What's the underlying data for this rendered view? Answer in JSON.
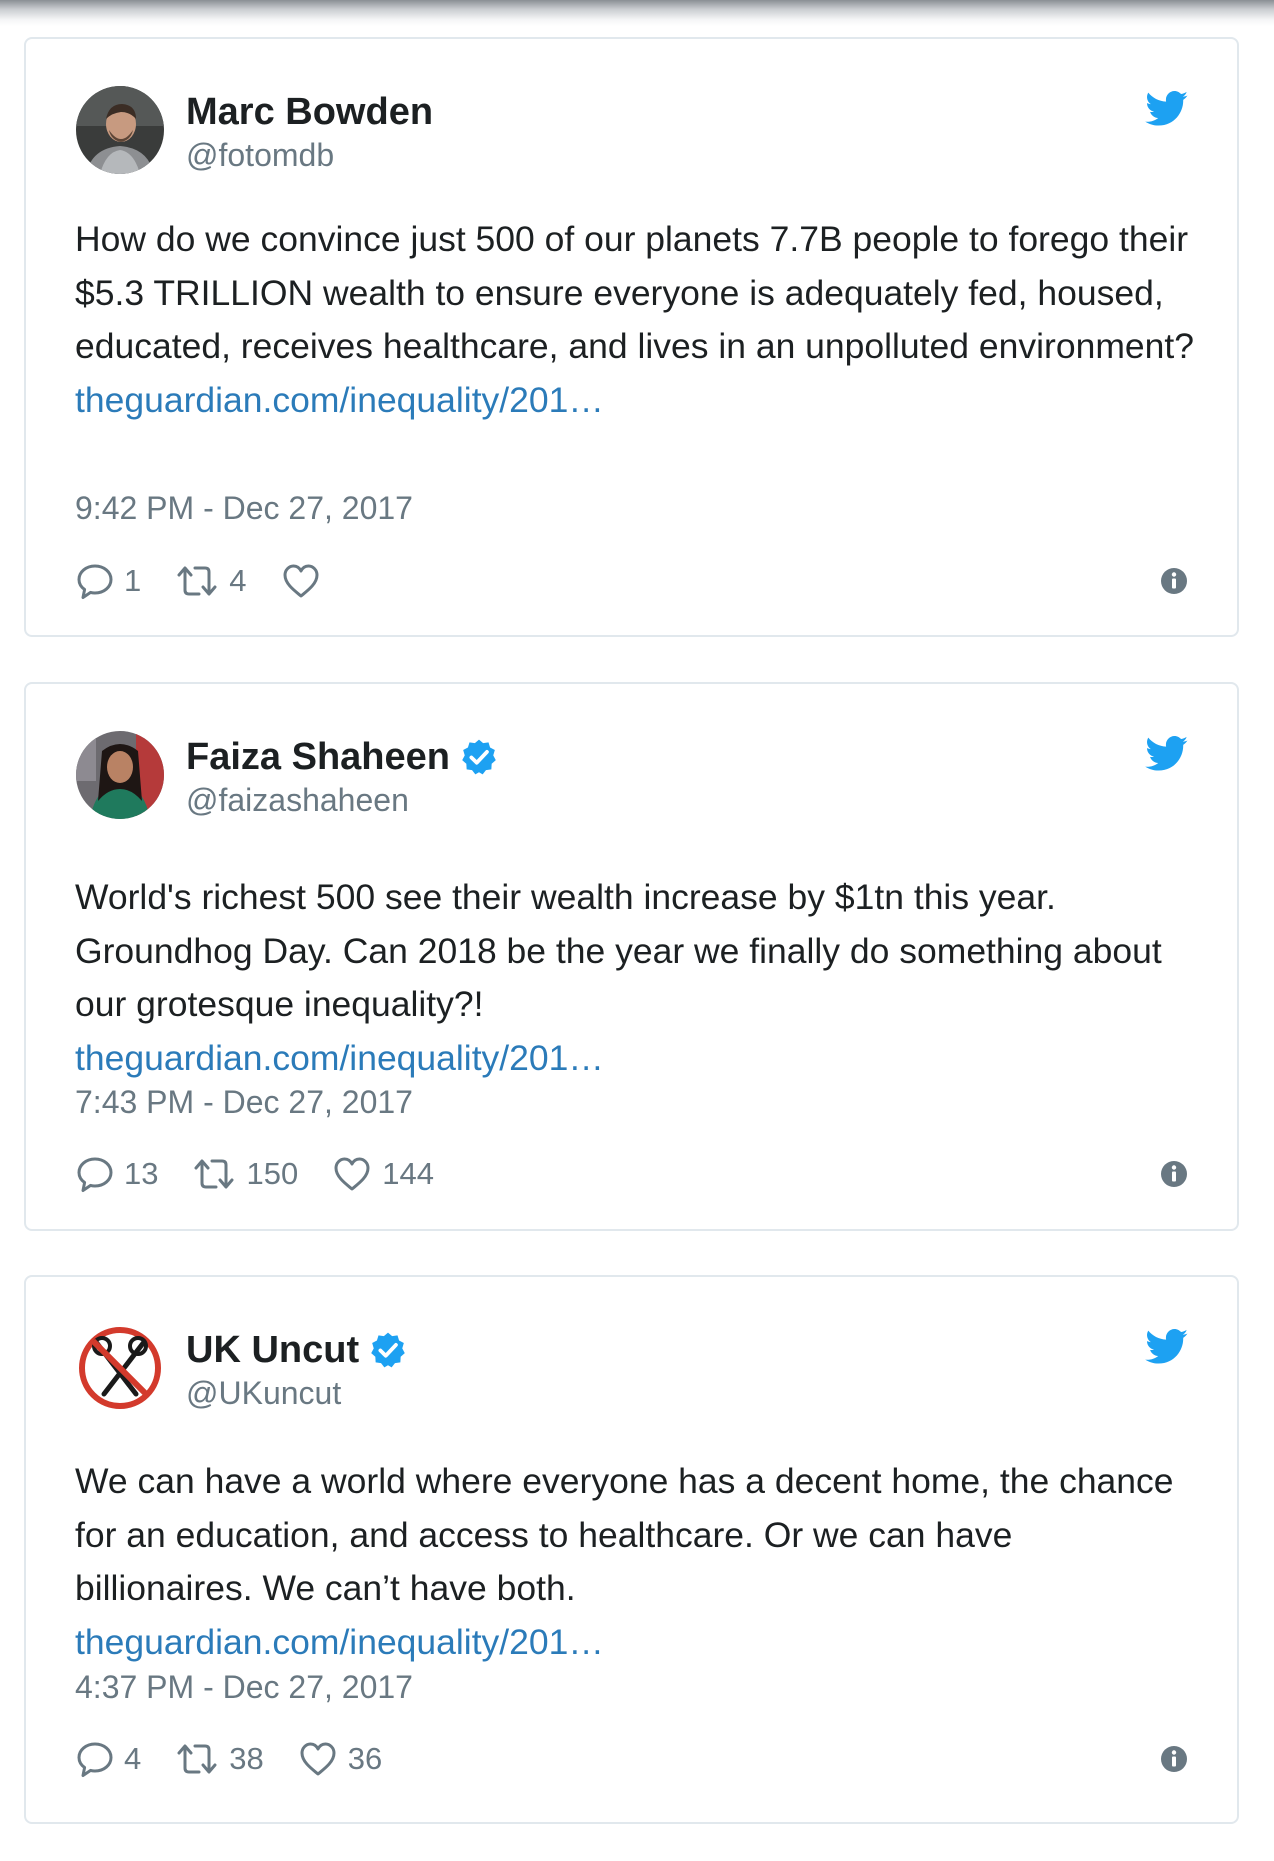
{
  "tweets": [
    {
      "name": "Marc Bowden",
      "handle": "@fotomdb",
      "verified": false,
      "text": "How do we convince just 500 of our planets 7.7B people to forego their $5.3 TRILLION wealth to ensure everyone is adequately fed, housed, educated, receives healthcare, and lives in an unpolluted environment?",
      "link": "theguardian.com/inequality/201…",
      "time": "9:42 PM - Dec 27, 2017",
      "replies": "1",
      "retweets": "4",
      "likes": ""
    },
    {
      "name": "Faiza Shaheen",
      "handle": "@faizashaheen",
      "verified": true,
      "text": "World's richest 500 see their wealth increase by $1tn this year. Groundhog Day. Can 2018 be the year we finally do something about our grotesque inequality?!",
      "link": "theguardian.com/inequality/201…",
      "time": "7:43 PM - Dec 27, 2017",
      "replies": "13",
      "retweets": "150",
      "likes": "144"
    },
    {
      "name": "UK Uncut",
      "handle": "@UKuncut",
      "verified": true,
      "text": "We can have a world where everyone has a decent home, the chance for an education, and access to healthcare. Or we can have billionaires. We can’t have both.",
      "link": "theguardian.com/inequality/201…",
      "time": "4:37 PM - Dec 27, 2017",
      "replies": "4",
      "retweets": "38",
      "likes": "36"
    }
  ],
  "colors": {
    "link": "#2b7bb9",
    "twitter_blue": "#1da1f2",
    "muted": "#697882",
    "text": "#1c2022",
    "border": "#e1e8ed"
  },
  "icons": {
    "brand": "twitter-bird-icon",
    "reply": "reply-icon",
    "retweet": "retweet-icon",
    "like": "heart-icon",
    "info": "info-icon",
    "verified": "verified-badge-icon"
  }
}
